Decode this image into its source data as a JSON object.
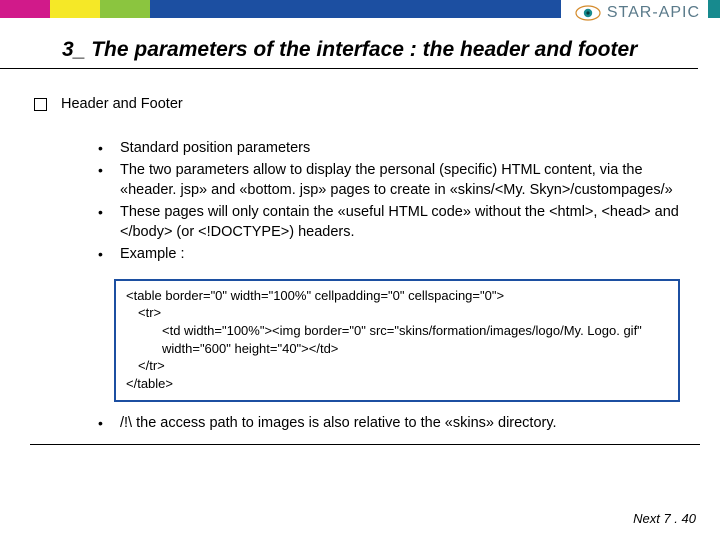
{
  "brand": {
    "name": "STAR-APIC"
  },
  "title": "3_ The parameters of the interface : the header and footer",
  "section_heading": "Header and Footer",
  "bullets": {
    "b1": "Standard position parameters",
    "b2": "The two parameters allow to display the personal (specific) HTML content, via the «header. jsp» and «bottom. jsp» pages to create in «skins/<My. Skyn>/custompages/»",
    "b3": "These pages will only contain the «useful HTML code» without the <html>, <head> and </body> (or <!DOCTYPE>) headers.",
    "b4": "Example :",
    "b5": "/!\\ the access path to images is also relative to the «skins» directory."
  },
  "code": {
    "l1": "<table border=\"0\" width=\"100%\" cellpadding=\"0\" cellspacing=\"0\">",
    "l2": "<tr>",
    "l3": "<td width=\"100%\"><img border=\"0\" src=\"skins/formation/images/logo/My. Logo. gif\" width=\"600\" height=\"40\"></td>",
    "l4": "</tr>",
    "l5": "</table>"
  },
  "footer": "Next 7 . 40"
}
